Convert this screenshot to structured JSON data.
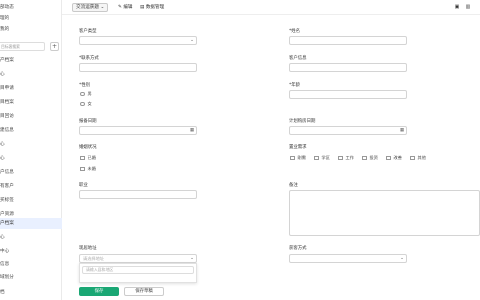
{
  "sidebar": {
    "items": [
      {
        "label": "部动态"
      },
      {
        "label": "理的"
      },
      {
        "label": "我的"
      },
      {
        "label": "产档案"
      },
      {
        "label": "心"
      },
      {
        "label": "目申请"
      },
      {
        "label": "目档案"
      },
      {
        "label": "目回访"
      },
      {
        "label": "建信息"
      },
      {
        "label": "心"
      },
      {
        "label": "心"
      },
      {
        "label": "户信息"
      },
      {
        "label": "有客户"
      },
      {
        "label": "买标签"
      },
      {
        "label": "户资源"
      },
      {
        "label": "户档案"
      },
      {
        "label": "心"
      },
      {
        "label": "中心"
      },
      {
        "label": "信息"
      },
      {
        "label": "域划分"
      },
      {
        "label": "档"
      }
    ],
    "search_placeholder": "目标客搜索",
    "add_label": "+"
  },
  "toolbar": {
    "dropdown_label": "交流运获题",
    "edit_label": "编辑",
    "manage_label": "数据管理"
  },
  "form": {
    "customer_type": {
      "label": "客户类型",
      "value": ""
    },
    "name": {
      "label": "*姓名",
      "value": ""
    },
    "contact": {
      "label": "*联系方式",
      "value": ""
    },
    "customer_source": {
      "label": "客户信息",
      "value": ""
    },
    "gender": {
      "label": "*性别",
      "options": [
        "男",
        "女"
      ]
    },
    "age": {
      "label": "*年龄",
      "value": ""
    },
    "report_date": {
      "label": "报备日期",
      "value": ""
    },
    "planned_date": {
      "label": "计划购房日期",
      "value": ""
    },
    "marital": {
      "label": "婚姻状况",
      "options": [
        "已婚",
        "未婚"
      ]
    },
    "purpose": {
      "label": "置业需求",
      "options": [
        "刚需",
        "学区",
        "工作",
        "投资",
        "改善",
        "其他"
      ]
    },
    "occupation": {
      "label": "职业",
      "value": ""
    },
    "notes": {
      "label": "备注",
      "value": ""
    },
    "visit_address": {
      "label": "现居地址",
      "placeholder": "请选择地址",
      "search_placeholder": "请输入县和地区"
    },
    "channel": {
      "label": "获客方式",
      "value": ""
    },
    "submit_label": "保存",
    "save_draft_label": "保存草稿"
  }
}
